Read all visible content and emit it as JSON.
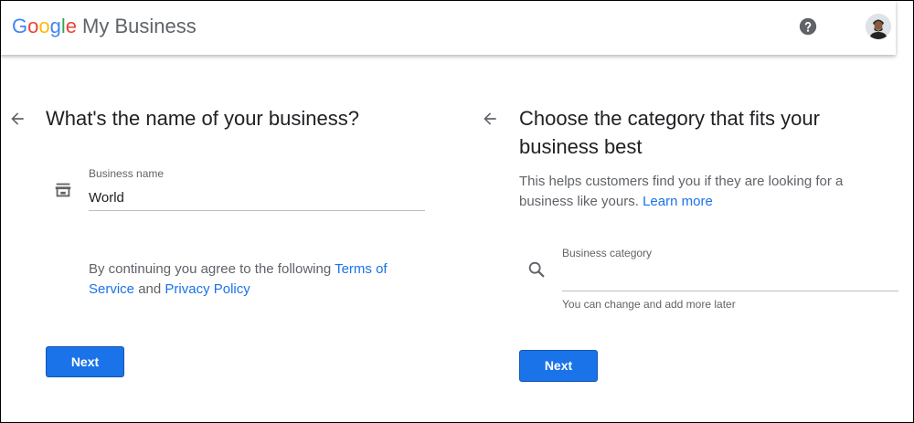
{
  "header": {
    "logo_parts": [
      "G",
      "o",
      "o",
      "g",
      "l",
      "e"
    ],
    "product_name": "My Business",
    "help_icon": "help-circle-icon",
    "avatar": "user-avatar"
  },
  "left_panel": {
    "back_icon": "arrow-back-icon",
    "title": "What's the name of your business?",
    "field_icon": "storefront-icon",
    "field_label": "Business name",
    "field_value": "World",
    "agreement_prefix": "By continuing you agree to the following ",
    "terms_link": "Terms of Service",
    "agreement_and": " and ",
    "privacy_link": "Privacy Policy",
    "next_button": "Next"
  },
  "right_panel": {
    "back_icon": "arrow-back-icon",
    "title_line1": "Choose the category that fits your",
    "title_line2": "business best",
    "description": "This helps customers find you if they are looking for a business like yours.",
    "learn_more_link": "Learn more",
    "field_icon": "search-icon",
    "field_label": "Business category",
    "field_value": "",
    "helper_text": "You can change and add more later",
    "next_button": "Next"
  },
  "colors": {
    "accent": "#1a73e8",
    "title_text": "#202124",
    "secondary_text": "#5f6368",
    "google_blue": "#4285F4",
    "google_red": "#EA4335",
    "google_yellow": "#FBBC05",
    "google_green": "#34A853"
  }
}
